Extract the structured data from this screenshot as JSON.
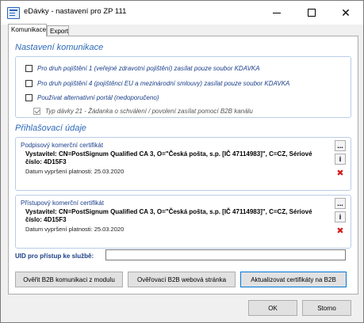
{
  "window": {
    "title": "eDávky - nastavení pro ZP 111"
  },
  "tabs": [
    {
      "label": "Komunikace",
      "active": true
    },
    {
      "label": "Export",
      "active": false
    }
  ],
  "komunikace": {
    "title": "Nastavení komunikace",
    "options": [
      {
        "label": "Pro druh pojištění 1 (veřejné zdravotní pojištění) zasílat pouze soubor KDAVKA",
        "checked": false
      },
      {
        "label": "Pro druh pojištění 4 (pojištěnci EU a mezinárodní smlouvy) zasílat pouze soubor KDAVKA",
        "checked": false
      },
      {
        "label": "Používat alternativní portál (nedoporučeno)",
        "checked": false
      },
      {
        "label": "Typ dávky 21 - Žádanka o schválení / povolení zasílat pomocí B2B kanálu",
        "checked": true
      }
    ]
  },
  "prihlasovaci": {
    "title": "Přihlašovací údaje",
    "podpisovy": {
      "title": "Podpisový komerční certifikát",
      "issuer": "Vystavitel: CN=PostSignum Qualified CA 3, O=\"Česká pošta, s.p. [IČ 47114983]\", C=CZ, Sériové číslo: 4D15F3",
      "expiry": "Datum vypršení platnosti: 25.03.2020"
    },
    "pristupovy": {
      "title": "Přístupový komerční certifikát",
      "issuer": "Vystavitel: CN=PostSignum Qualified CA 3, O=\"Česká pošta, s.p. [IČ 47114983]\", C=CZ, Sériové číslo: 4D15F3",
      "expiry": "Datum vypršení platnosti: 25.03.2020"
    },
    "side_buttons": {
      "browse": "...",
      "info": "i",
      "delete": "✖"
    },
    "uid_label": "UID pro přístup ke službě:",
    "uid_value": ""
  },
  "actions": {
    "verify": "Ověřit B2B komunikaci z modulu",
    "webpage": "Ověřovací B2B webová stránka",
    "update": "Aktualizovat certifikáty na B2B"
  },
  "footer": {
    "ok": "OK",
    "cancel": "Storno"
  }
}
